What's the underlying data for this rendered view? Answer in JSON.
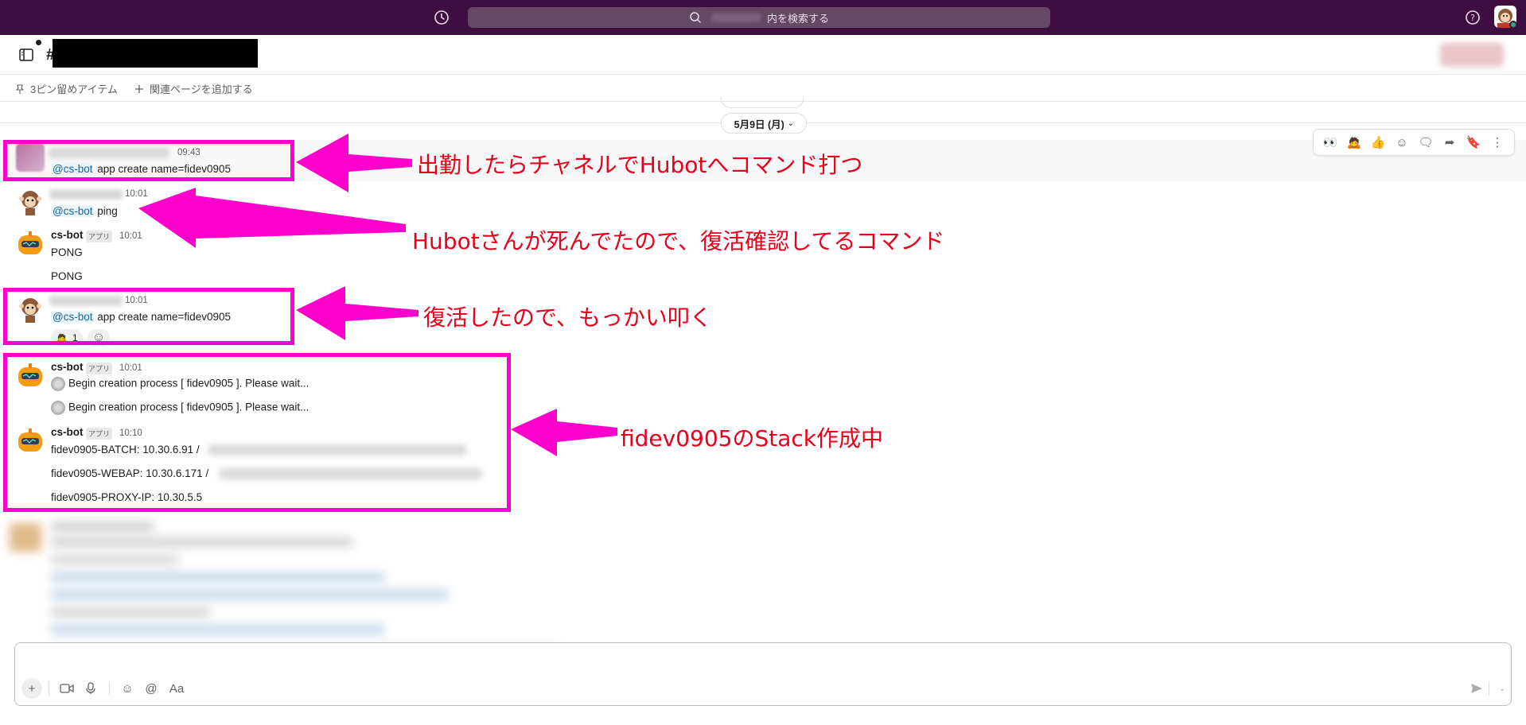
{
  "topbar": {
    "search_text": "内を検索する"
  },
  "channel": {
    "hash": "#"
  },
  "bookmarks": {
    "pinned_label": "3ピン留めアイテム",
    "add_page_label": "関連ページを追加する"
  },
  "date_divider": {
    "label": "5月9日 (月)"
  },
  "messages": [
    {
      "time": "09:43",
      "mention": "@cs-bot",
      "text": "app create name=fidev0905"
    },
    {
      "time": "10:01",
      "mention": "@cs-bot",
      "text": "ping"
    },
    {
      "name": "cs-bot",
      "badge": "アプリ",
      "time": "10:01",
      "lines": [
        "PONG",
        "PONG"
      ]
    },
    {
      "time": "10:01",
      "mention": "@cs-bot",
      "text": "app create name=fidev0905",
      "reaction_count": "1"
    },
    {
      "name": "cs-bot",
      "badge": "アプリ",
      "time": "10:01",
      "lines": [
        "Begin creation process [ fidev0905 ]. Please wait...",
        "Begin creation process [ fidev0905 ]. Please wait..."
      ]
    },
    {
      "name": "cs-bot",
      "badge": "アプリ",
      "time": "10:10",
      "lines": [
        "fidev0905-BATCH: 10.30.6.91 /",
        "fidev0905-WEBAP: 10.30.6.171 /",
        "fidev0905-PROXY-IP: 10.30.5.5"
      ]
    }
  ],
  "annotations": [
    "出勤したらチャネルでHubotへコマンド打つ",
    "Hubotさんが死んでたので、復活確認してるコマンド",
    "復活したので、もっかい叩く",
    "fidev0905のStack作成中"
  ],
  "composer": {
    "format_label": "Aa"
  },
  "colors": {
    "topbar": "#3f0e40",
    "annotation_box": "#ff00cc",
    "annotation_text": "#e8001c",
    "mention": "#1264a3"
  }
}
